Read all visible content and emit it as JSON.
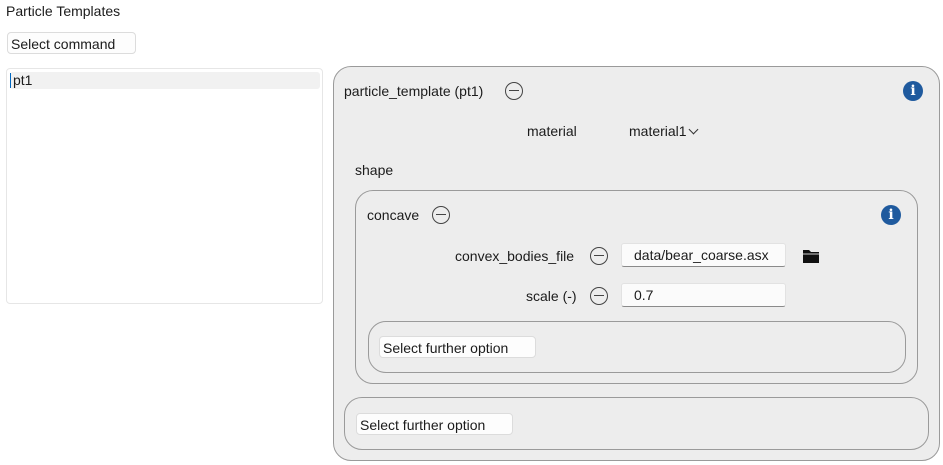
{
  "header": {
    "title": "Particle Templates"
  },
  "command": {
    "label": "Select command"
  },
  "templates_list": {
    "items": [
      "pt1"
    ]
  },
  "template_panel": {
    "title": "particle_template (pt1)",
    "material": {
      "label": "material",
      "value": "material1"
    },
    "shape_label": "shape",
    "concave": {
      "title": "concave",
      "convex_bodies_file": {
        "label": "convex_bodies_file",
        "value": "data/bear_coarse.asx"
      },
      "scale": {
        "label": "scale (-)",
        "value": "0.7"
      },
      "further_option": "Select further option"
    },
    "further_option": "Select further option"
  },
  "icons": {
    "info": "info-icon",
    "minus": "minus-circle-icon",
    "folder": "folder-icon",
    "chevron": "chevron-down-icon"
  },
  "colors": {
    "info_blue": "#1f5a9e",
    "panel_bg": "#ededed",
    "caret": "#0067c0"
  }
}
